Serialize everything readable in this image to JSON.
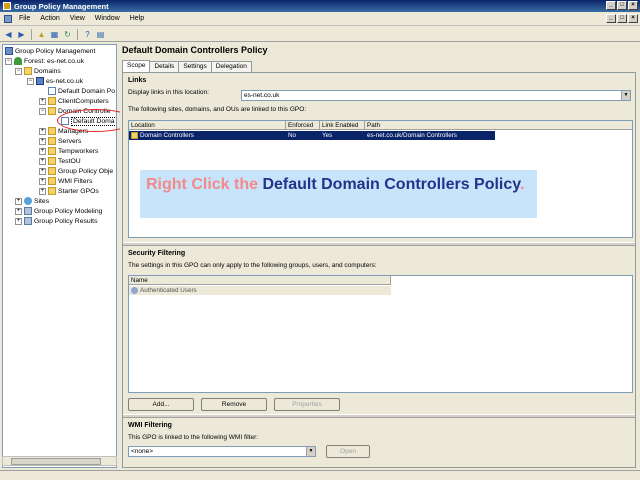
{
  "window": {
    "title": "Group Policy Management"
  },
  "menu": {
    "items": [
      "File",
      "Action",
      "View",
      "Window",
      "Help"
    ]
  },
  "toolbar": {
    "icons": [
      "back-icon",
      "forward-icon",
      "up-icon",
      "show-hide-tree-icon",
      "refresh-icon",
      "help-icon",
      "properties-icon"
    ]
  },
  "tree": {
    "root": "Group Policy Management",
    "forest": "Forest: es-net.co.uk",
    "domains": "Domains",
    "domain": "es-net.co.uk",
    "default_domain_policy": "Default Domain Po",
    "client_computers": "ClientComputers",
    "domain_controllers": "Domain Controlle",
    "default_dc_policy": "Default Doma",
    "managers": "Managers",
    "servers": "Servers",
    "temporary_workers": "Tempworkers",
    "test_ou": "TestOU",
    "gpo_objects": "Group Policy Obje",
    "wmi_filters": "WMI Filters",
    "starter_gpos": "Starter GPOs",
    "sites": "Sites",
    "gp_modeling": "Group Policy Modeling",
    "gp_results": "Group Policy Results"
  },
  "pane": {
    "title": "Default Domain Controllers Policy",
    "tabs": [
      "Scope",
      "Details",
      "Settings",
      "Delegation"
    ],
    "links": {
      "heading": "Links",
      "display_label": "Display links in this location:",
      "display_value": "es-net.co.uk",
      "description": "The following sites, domains, and OUs are linked to this GPO:",
      "columns": [
        "Location",
        "Enforced",
        "Link Enabled",
        "Path"
      ],
      "rows": [
        {
          "location": "Domain Controllers",
          "enforced": "No",
          "link_enabled": "Yes",
          "path": "es-net.co.uk/Domain Controllers"
        }
      ]
    },
    "security": {
      "heading": "Security Filtering",
      "description": "The settings in this GPO can only apply to the following groups, users, and computers:",
      "columns": [
        "Name"
      ],
      "rows": [
        "Authenticated Users"
      ],
      "buttons": {
        "add": "Add...",
        "remove": "Remove",
        "properties": "Properties"
      }
    },
    "wmi": {
      "heading": "WMI Filtering",
      "description": "This GPO is linked to the following WMI filter:",
      "value": "<none>",
      "open_button": "Open"
    }
  },
  "callout": {
    "part1": "Right Click the ",
    "part2": "Default Domain Controllers Policy",
    "part3": "."
  },
  "colors": {
    "callout_bg": "#c8e4fb",
    "callout_pink": "#f38a8a",
    "callout_navy": "#25318a",
    "selection": "#0a246a",
    "highlight_oval": "#e02020"
  }
}
